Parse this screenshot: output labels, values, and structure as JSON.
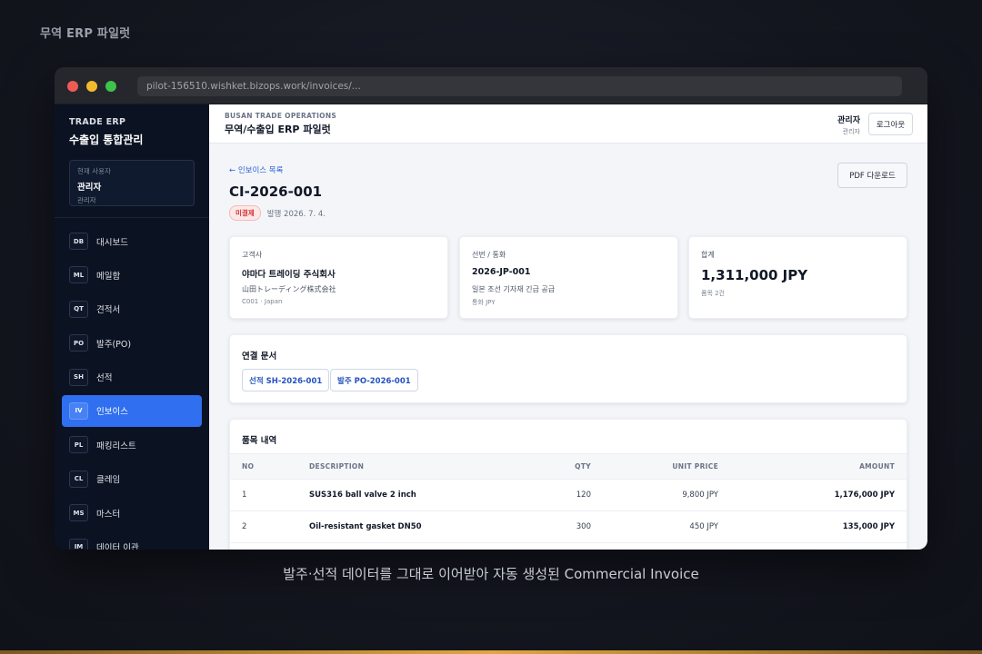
{
  "page_label": "무역 ERP 파일럿",
  "caption": "발주·선적 데이터를 그대로 이어받아 자동 생성된 Commercial Invoice",
  "browser": {
    "url": "pilot-156510.wishket.bizops.work/invoices/..."
  },
  "sidebar": {
    "brand_small": "TRADE ERP",
    "brand_title": "수출입 통합관리",
    "user_caption": "현재 사용자",
    "user_name": "관리자",
    "user_role": "관리자",
    "items": [
      {
        "code": "DB",
        "label": "대시보드",
        "active": false
      },
      {
        "code": "ML",
        "label": "메일함",
        "active": false
      },
      {
        "code": "QT",
        "label": "견적서",
        "active": false
      },
      {
        "code": "PO",
        "label": "발주(PO)",
        "active": false
      },
      {
        "code": "SH",
        "label": "선적",
        "active": false
      },
      {
        "code": "IV",
        "label": "인보이스",
        "active": true
      },
      {
        "code": "PL",
        "label": "패킹리스트",
        "active": false
      },
      {
        "code": "CL",
        "label": "클레임",
        "active": false
      },
      {
        "code": "MS",
        "label": "마스터",
        "active": false
      },
      {
        "code": "IM",
        "label": "데이터 이관",
        "active": false
      }
    ]
  },
  "topbar": {
    "subtitle": "BUSAN TRADE OPERATIONS",
    "title": "무역/수출입 ERP 파일럿",
    "user_name": "관리자",
    "user_role": "관리자",
    "logout_label": "로그아웃"
  },
  "invoice": {
    "back_label": "← 인보이스 목록",
    "number": "CI-2026-001",
    "status": "미결제",
    "issued": "발행 2026. 7. 4.",
    "pdf_label": "PDF 다운로드",
    "customer": {
      "label": "고객사",
      "name": "야마다 트레이딩 주식회사",
      "name_local": "山田トレーディング株式会社",
      "meta": "C001 · Japan"
    },
    "shipment": {
      "label": "선번 / 통화",
      "number": "2026-JP-001",
      "desc": "일본 조선 기자재 긴급 공급",
      "currency": "통화 JPY"
    },
    "total": {
      "label": "합계",
      "value": "1,311,000 JPY",
      "note": "품목 2건"
    },
    "linked": {
      "title": "연결 문서",
      "docs": [
        "선적 SH-2026-001",
        "발주 PO-2026-001"
      ]
    },
    "items_section": {
      "title": "품목 내역",
      "headers": [
        "NO",
        "DESCRIPTION",
        "QTY",
        "UNIT PRICE",
        "AMOUNT"
      ],
      "rows": [
        {
          "no": "1",
          "desc": "SUS316 ball valve 2 inch",
          "qty": "120",
          "unit": "9,800 JPY",
          "amount": "1,176,000 JPY"
        },
        {
          "no": "2",
          "desc": "Oil-resistant gasket DN50",
          "qty": "300",
          "unit": "450 JPY",
          "amount": "135,000 JPY"
        }
      ]
    }
  },
  "colors": {
    "accent": "#2f6ff0",
    "sidebar_bg": "#0b1221",
    "status_red": "#d32f2f",
    "link_blue": "#2f62d6"
  }
}
